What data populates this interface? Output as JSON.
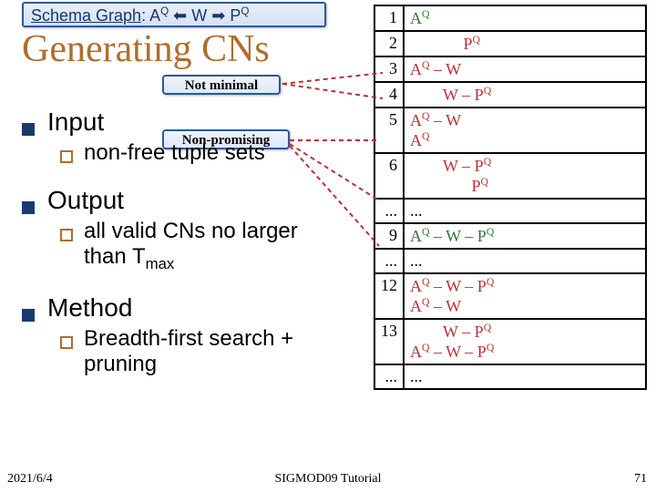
{
  "schema_graph": "Schema Graph: A",
  "schema_graph_mid": " ⬅ W ➡ P",
  "title": "Generating CNs",
  "callouts": {
    "not_minimal": "Not minimal",
    "non_promising": "Non-promising"
  },
  "bullets": {
    "input": "Input",
    "input_sub": "non-free tuple sets",
    "output": "Output",
    "output_sub_a": "all valid CNs no larger than T",
    "output_sub_max": "max",
    "method": "Method",
    "method_sub": "Breadth-first search + pruning"
  },
  "rows": [
    {
      "idx": "1",
      "cls": "green"
    },
    {
      "idx": "2",
      "cls": "red"
    },
    {
      "idx": "3",
      "cls": "red"
    },
    {
      "idx": "4",
      "cls": "red"
    },
    {
      "idx": "5",
      "cls": "red"
    },
    {
      "idx": "6",
      "cls": "red"
    },
    {
      "idx": "...",
      "cls": ""
    },
    {
      "idx": "9",
      "cls": "green"
    },
    {
      "idx": "...",
      "cls": ""
    },
    {
      "idx": "12",
      "cls": "red"
    },
    {
      "idx": "13",
      "cls": "red"
    },
    {
      "idx": "...",
      "cls": ""
    }
  ],
  "cells": {
    "r1": "A<sup>Q</sup>",
    "r2": "&nbsp;&nbsp;&nbsp;&nbsp;&nbsp;&nbsp;&nbsp;&nbsp;&nbsp;&nbsp;&nbsp;&nbsp;&nbsp;P<sup>Q</sup>",
    "r3": "A<sup>Q</sup> &ndash; W",
    "r4": "&nbsp;&nbsp;&nbsp;&nbsp;&nbsp;&nbsp;&nbsp;&nbsp;W &ndash; P<sup>Q</sup>",
    "r5": "A<sup>Q</sup> &ndash; W<br>A<sup>Q</sup>",
    "r6": "&nbsp;&nbsp;&nbsp;&nbsp;&nbsp;&nbsp;&nbsp;&nbsp;W &ndash; P<sup>Q</sup><br>&nbsp;&nbsp;&nbsp;&nbsp;&nbsp;&nbsp;&nbsp;&nbsp;&nbsp;&nbsp;&nbsp;&nbsp;&nbsp;&nbsp;&nbsp;P<sup>Q</sup>",
    "r7": "...",
    "r9": "A<sup>Q</sup> &ndash; W &ndash; P<sup>Q</sup>",
    "r10": "...",
    "r12": "A<sup>Q</sup> &ndash; W &ndash; P<sup>Q</sup><br>A<sup>Q</sup> &ndash; W",
    "r13": "&nbsp;&nbsp;&nbsp;&nbsp;&nbsp;&nbsp;&nbsp;&nbsp;W &ndash; P<sup>Q</sup><br>A<sup>Q</sup> &ndash; W &ndash; P<sup>Q</sup>",
    "r14": "..."
  },
  "footer": {
    "date": "2021/6/4",
    "title": "SIGMOD09 Tutorial",
    "page": "71"
  }
}
